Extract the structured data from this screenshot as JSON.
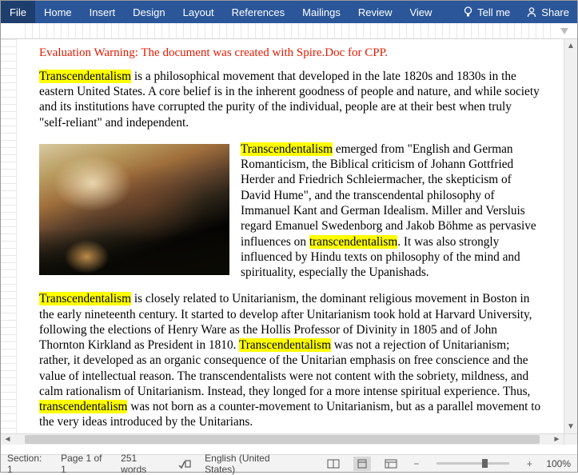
{
  "ribbon": {
    "tabs": [
      "File",
      "Home",
      "Insert",
      "Design",
      "Layout",
      "References",
      "Mailings",
      "Review",
      "View"
    ],
    "tellme": "Tell me",
    "share": "Share"
  },
  "warning": "Evaluation Warning: The document was created with Spire.Doc for CPP.",
  "p1": {
    "hl": "Transcendentalism",
    "rest": " is a philosophical movement that developed in the late 1820s and 1830s in the eastern United States. A core belief is in the inherent goodness of people and nature, and while society and its institutions have corrupted the purity of the individual, people are at their best when truly \"self-reliant\" and independent."
  },
  "p2": {
    "hl1": "Transcendentalism",
    "mid1": " emerged from \"English and German Romanticism, the Biblical criticism of Johann Gottfried Herder and Friedrich Schleiermacher, the skepticism of David Hume\", and the transcendental philosophy of Immanuel Kant and German Idealism. Miller and Versluis regard Emanuel Swedenborg and Jakob Böhme as pervasive influences on ",
    "hl2": "transcendentalism",
    "mid2": ". It was also strongly influenced by Hindu texts on philosophy of the mind and spirituality, especially the Upanishads."
  },
  "p3": {
    "hl1": "Transcendentalism",
    "mid1": " is closely related to Unitarianism, the dominant religious movement in Boston in the early nineteenth century. It started to develop after Unitarianism took hold at Harvard University, following the elections of Henry Ware as the Hollis Professor of Divinity in 1805 and of John Thornton Kirkland as President in 1810. ",
    "hl2": "Transcendentalism",
    "mid2": " was not a rejection of Unitarianism; rather, it developed as an organic consequence of the Unitarian emphasis on free conscience and the value of intellectual reason. The transcendentalists were not content with the sobriety, mildness, and calm rationalism of Unitarianism. Instead, they longed for a more intense spiritual experience. Thus, ",
    "hl3": "transcendentalism",
    "mid3": " was not born as a counter-movement to Unitarianism, but as a parallel movement to the very ideas introduced by the Unitarians."
  },
  "status": {
    "section": "Section: 1",
    "page": "Page 1 of 1",
    "words": "251 words",
    "lang": "English (United States)",
    "zoom": "100%"
  }
}
